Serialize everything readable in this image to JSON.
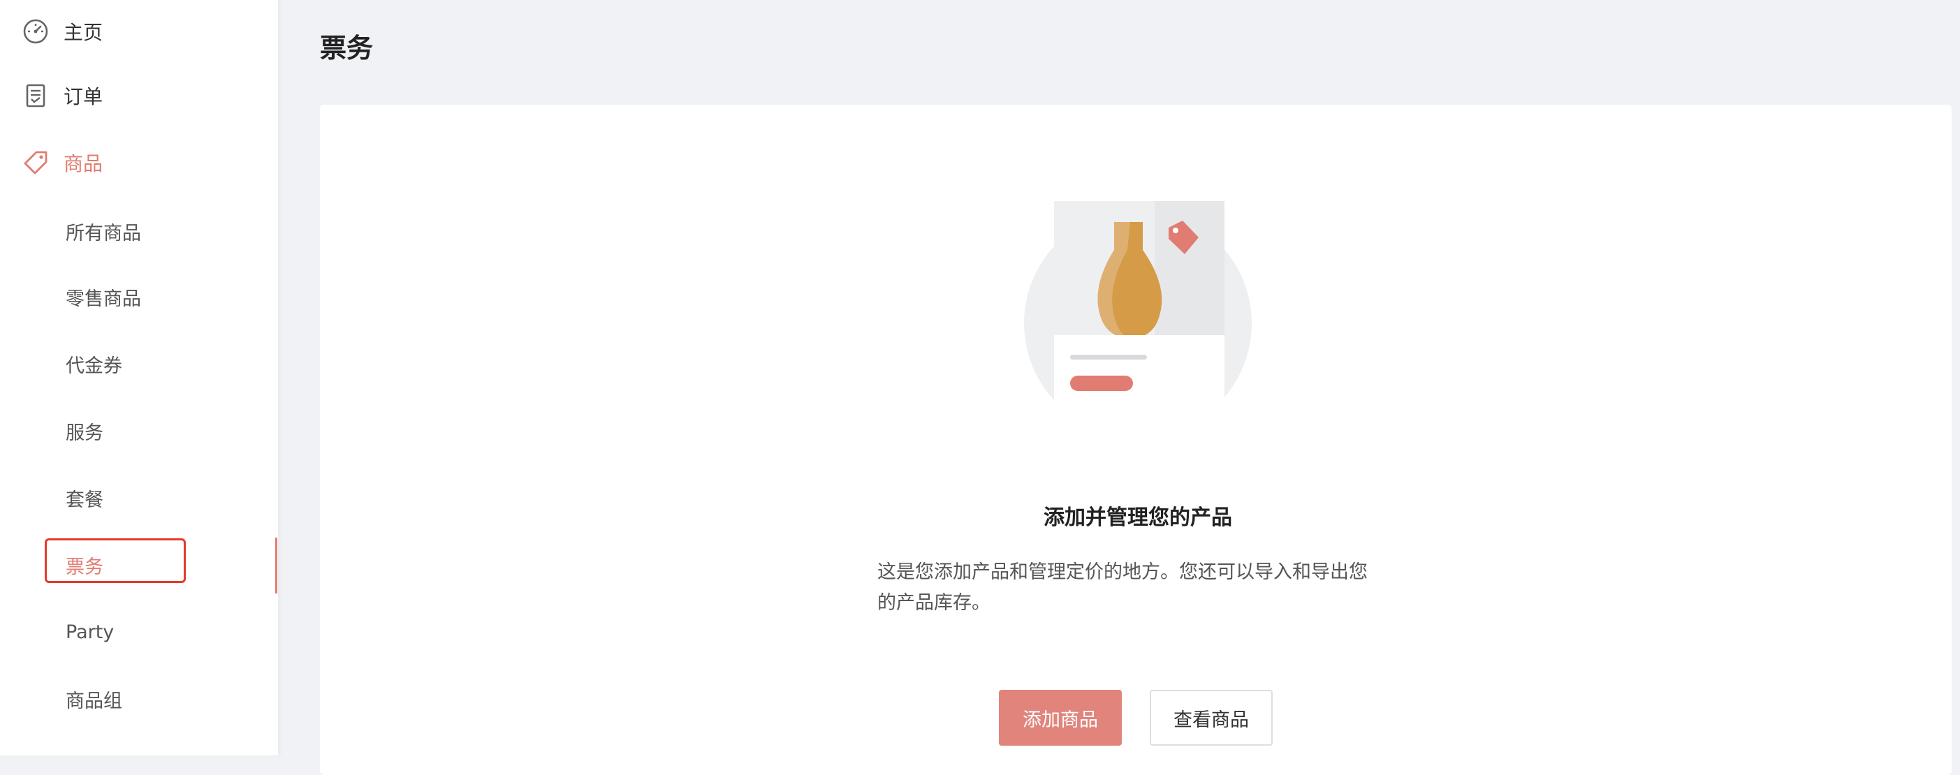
{
  "sidebar": {
    "items": [
      {
        "label": "主页",
        "icon": "dashboard-icon"
      },
      {
        "label": "订单",
        "icon": "order-icon"
      },
      {
        "label": "商品",
        "icon": "tag-icon"
      }
    ],
    "sub_items": [
      {
        "label": "所有商品"
      },
      {
        "label": "零售商品"
      },
      {
        "label": "代金券"
      },
      {
        "label": "服务"
      },
      {
        "label": "套餐"
      },
      {
        "label": "票务"
      },
      {
        "label": "Party"
      },
      {
        "label": "商品组"
      }
    ],
    "active_color": "#e07c72"
  },
  "page": {
    "title": "票务"
  },
  "empty_state": {
    "title": "添加并管理您的产品",
    "desc_line1": "这是您添加产品和管理定价的地方。您还可以导入和导出您",
    "desc_line2": "的产品库存。",
    "primary_button": "添加商品",
    "secondary_button": "查看商品"
  },
  "colors": {
    "accent": "#e07c72",
    "primary_button": "#e0847c",
    "highlight_border": "#e43a2b",
    "background": "#f1f2f5"
  }
}
